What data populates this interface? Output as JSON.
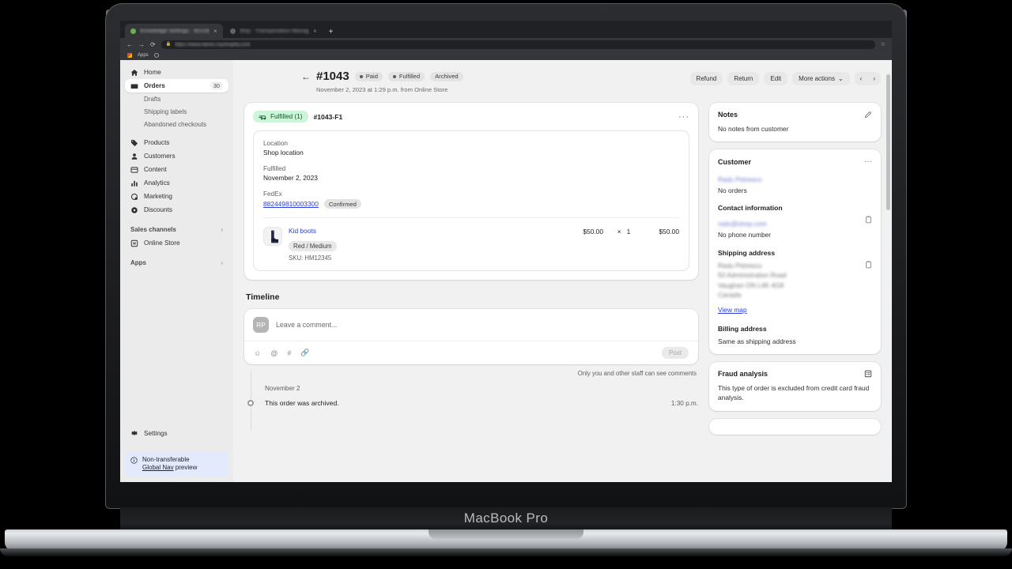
{
  "device": {
    "label": "MacBook Pro"
  },
  "browser": {
    "tabs": [
      {
        "title": "Knowledge Settings · 4Cccb",
        "favicon": "green-dot-favicon",
        "active": true,
        "close_label": "×"
      },
      {
        "title": "Ship · Transportation Manag",
        "favicon": "grey-dot-favicon",
        "active": false,
        "close_label": "×"
      }
    ],
    "new_tab_label": "+",
    "nav": {
      "back": "←",
      "forward": "→",
      "reload": "⟳"
    },
    "omnibox": {
      "lock_icon": "lock-icon",
      "value": "https://www.demo.myshopify.com"
    },
    "star_icon": "star-icon",
    "bookmarks": {
      "apps_label": "Apps",
      "profile_icon": "profile-icon"
    }
  },
  "sidebar": {
    "items": [
      {
        "label": "Home",
        "icon": "home-icon",
        "selected": false,
        "count": ""
      },
      {
        "label": "Orders",
        "icon": "orders-icon",
        "selected": true,
        "count": "30"
      }
    ],
    "sub_items": [
      "Drafts",
      "Shipping labels",
      "Abandoned checkouts"
    ],
    "items2": [
      {
        "label": "Products",
        "icon": "tag-icon"
      },
      {
        "label": "Customers",
        "icon": "person-icon"
      },
      {
        "label": "Content",
        "icon": "content-icon"
      },
      {
        "label": "Analytics",
        "icon": "analytics-icon"
      },
      {
        "label": "Marketing",
        "icon": "marketing-icon"
      },
      {
        "label": "Discounts",
        "icon": "discount-icon"
      }
    ],
    "sales_channels": {
      "label": "Sales channels",
      "chevron": "›"
    },
    "online_store": {
      "label": "Online Store",
      "icon": "store-icon"
    },
    "apps_section": {
      "label": "Apps",
      "chevron": "›"
    },
    "settings": {
      "label": "Settings",
      "icon": "gear-icon"
    },
    "notice": {
      "icon": "info-icon",
      "line1": "Non-transferable",
      "link": "Global Nav",
      "line2_rest": " preview"
    }
  },
  "header": {
    "back_arrow": "←",
    "order_number": "#1043",
    "badges": [
      {
        "label": "Paid",
        "dot": true
      },
      {
        "label": "Fulfilled",
        "dot": true
      },
      {
        "label": "Archived",
        "dot": false
      }
    ],
    "subtitle": "November 2, 2023 at 1:29 p.m. from Online Store",
    "actions": [
      "Refund",
      "Return",
      "Edit"
    ],
    "more_actions": {
      "label": "More actions",
      "chevron": "⌄"
    },
    "prev": "‹",
    "next": "›"
  },
  "fulfillment": {
    "badge": {
      "icon": "delivery-truck-icon",
      "label": "Fulfilled (1)"
    },
    "name": "#1043-F1",
    "menu": "···",
    "location_label": "Location",
    "location_value": "Shop location",
    "fulfilled_label": "Fulfilled",
    "fulfilled_value": "November 2, 2023",
    "carrier_label": "FedEx",
    "tracking_number": "882449810003300",
    "tracking_status": "Confirmed",
    "line_item": {
      "thumbnail": "boot-product-image",
      "title": "Kid boots",
      "variant": "Red / Medium",
      "sku": "SKU: HM12345",
      "price": "$50.00",
      "multiply": "×",
      "quantity": "1",
      "total": "$50.00"
    }
  },
  "timeline": {
    "heading": "Timeline",
    "avatar_initials": "RP",
    "comment_placeholder": "Leave a comment...",
    "toolbar_icons": [
      "emoji-icon",
      "mention-icon",
      "hashtag-icon",
      "attachment-icon"
    ],
    "post_label": "Post",
    "privacy_note": "Only you and other staff can see comments",
    "events": [
      {
        "date": "November 2",
        "text": "This order was archived.",
        "time": "1:30 p.m."
      }
    ]
  },
  "notes": {
    "title": "Notes",
    "edit_icon": "pencil-icon",
    "body": "No notes from customer"
  },
  "customer": {
    "title": "Customer",
    "menu": "···",
    "name_redacted": "Radu Petrescu",
    "orders": "No orders",
    "contact_heading": "Contact information",
    "email_redacted": "radu@shop.com",
    "phone": "No phone number",
    "copy_icon": "copy-icon",
    "shipping_heading": "Shipping address",
    "shipping_lines_redacted": [
      "Radu Petrescu",
      "50 Administration Road",
      "Vaughan ON L4K 4G8",
      "Canada"
    ],
    "view_map": "View map",
    "billing_heading": "Billing address",
    "billing_value": "Same as shipping address"
  },
  "fraud": {
    "title": "Fraud analysis",
    "icon": "report-icon",
    "body": "This type of order is excluded from credit card fraud analysis."
  }
}
